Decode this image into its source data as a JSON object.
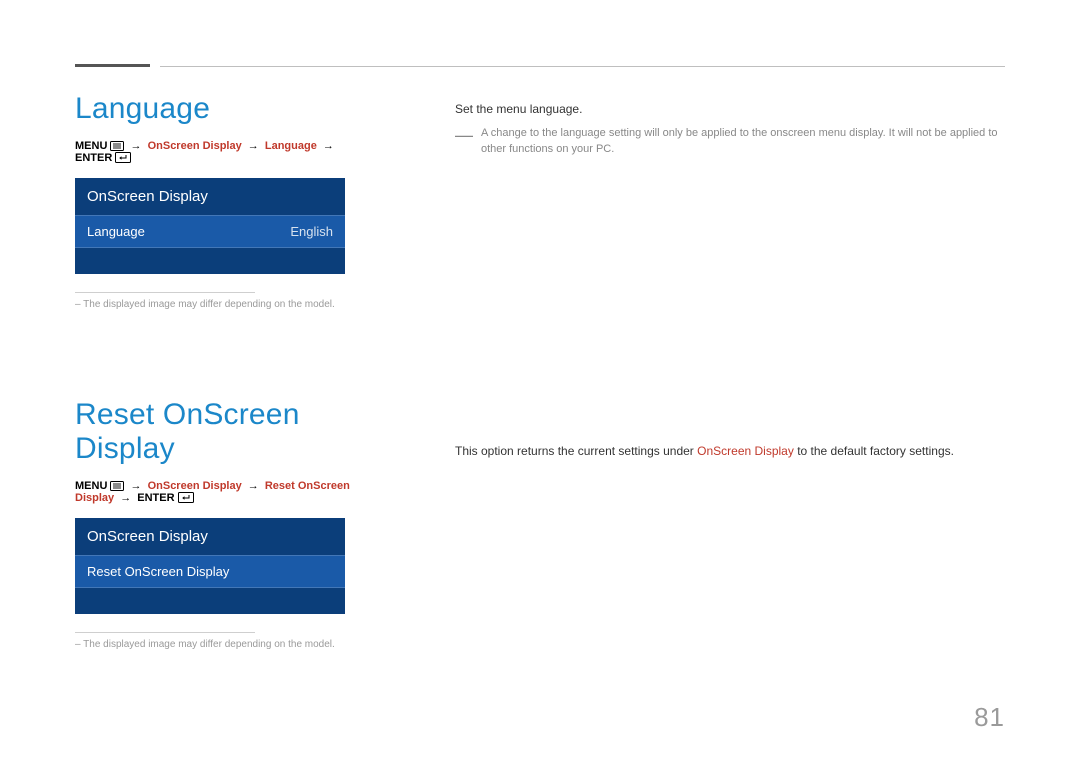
{
  "page_number": "81",
  "section1": {
    "title": "Language",
    "path": {
      "menu": "MENU",
      "p1": "OnScreen Display",
      "p2": "Language",
      "enter": "ENTER"
    },
    "osd": {
      "header": "OnScreen Display",
      "row1_label": "Language",
      "row1_value": "English"
    },
    "footnote": "–  The displayed image may differ depending on the model.",
    "right": {
      "lead": "Set the menu language.",
      "note": "A change to the language setting will only be applied to the onscreen menu display. It will not be applied to other functions on your PC."
    }
  },
  "section2": {
    "title": "Reset OnScreen Display",
    "path": {
      "menu": "MENU",
      "p1": "OnScreen Display",
      "p2": "Reset OnScreen Display",
      "enter": "ENTER"
    },
    "osd": {
      "header": "OnScreen Display",
      "row1_label": "Reset OnScreen Display"
    },
    "footnote": "–  The displayed image may differ depending on the model.",
    "right": {
      "desc_before": "This option returns the current settings under ",
      "desc_link": "OnScreen Display",
      "desc_after": " to the default factory settings."
    }
  }
}
